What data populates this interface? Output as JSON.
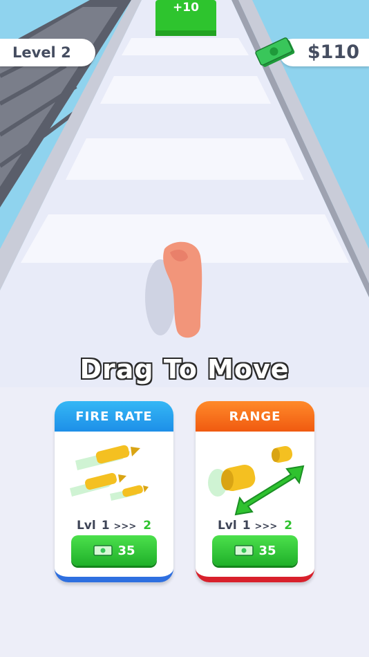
{
  "hud": {
    "level_label": "Level 2",
    "money": "$110",
    "money_icon": "cash-stack-icon"
  },
  "track": {
    "gate_label": "+10"
  },
  "hint_text": "Drag To Move",
  "upgrades": [
    {
      "title": "FIRE RATE",
      "lvl_prefix": "Lvl",
      "lvl_current": "1",
      "arrows": ">>>",
      "lvl_next": "2",
      "price": "35",
      "icon": "bullets-icon",
      "header_color": "#1d8fe8",
      "accent_color": "#2e6fe0"
    },
    {
      "title": "RANGE",
      "lvl_prefix": "Lvl",
      "lvl_current": "1",
      "arrows": ">>>",
      "lvl_next": "2",
      "price": "35",
      "icon": "range-arrow-icon",
      "header_color": "#f05a10",
      "accent_color": "#d8202c"
    }
  ],
  "colors": {
    "sky": "#8fd3ee",
    "track": "#e8ebf8",
    "money_green": "#2fc22f"
  }
}
